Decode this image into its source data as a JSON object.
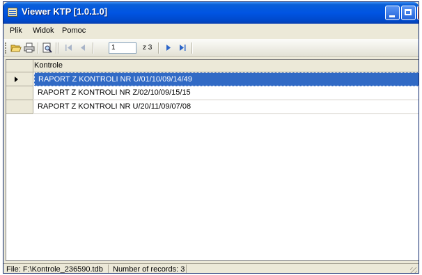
{
  "window": {
    "title": "Viewer KTP [1.0.1.0]"
  },
  "menu": {
    "items": [
      "Plik",
      "Widok",
      "Pomoc"
    ]
  },
  "toolbar": {
    "position_value": "1",
    "of_total": "z 3",
    "icons": [
      "open-folder-icon",
      "print-icon",
      "print-preview-icon",
      "first-record-icon",
      "previous-record-icon",
      "next-record-icon",
      "last-record-icon"
    ]
  },
  "grid": {
    "column_header": "Kontrole",
    "rows": [
      "RAPORT Z KONTROLI NR U/01/10/09/14/49",
      "RAPORT Z KONTROLI NR Z/02/10/09/15/15",
      "RAPORT Z KONTROLI NR U/20/11/09/07/08"
    ],
    "selected_index": 0
  },
  "status": {
    "file": "File: F:\\Kontrole_236590.tdb",
    "records": "Number of records: 3"
  },
  "colors": {
    "titlebar": "#0054e3",
    "selection": "#316ac5",
    "chrome": "#ece9d8"
  }
}
